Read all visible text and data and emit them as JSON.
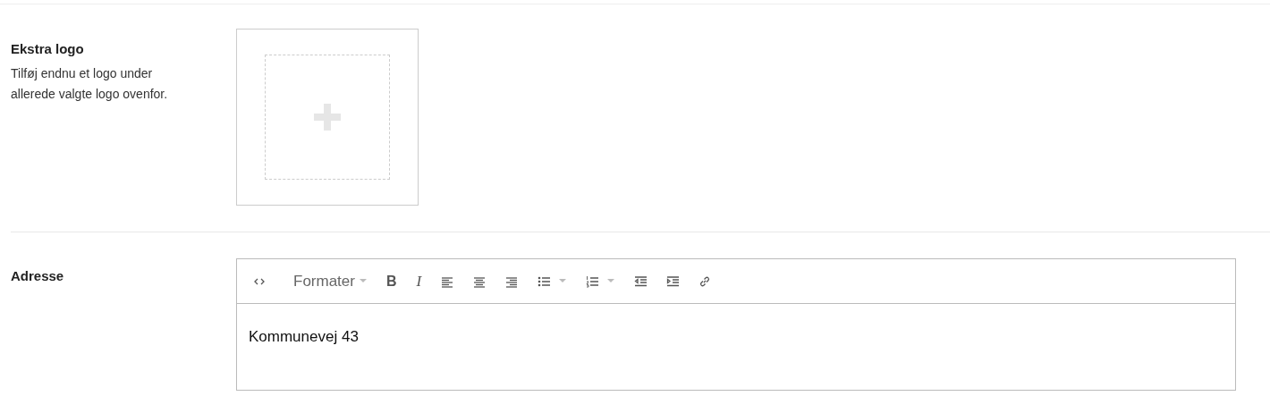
{
  "sections": [
    {
      "kind": "upload",
      "label": "Ekstra logo",
      "description": "Tilføj endnu et logo under allerede valgte logo ovenfor."
    },
    {
      "kind": "editor",
      "label": "Adresse",
      "toolbar": [
        {
          "kind": "code"
        },
        {
          "kind": "format",
          "label": "Formater"
        },
        {
          "kind": "bold",
          "label": "B"
        },
        {
          "kind": "italic",
          "label": "I"
        },
        {
          "kind": "align-left"
        },
        {
          "kind": "align-center"
        },
        {
          "kind": "align-right"
        },
        {
          "kind": "bullet-list"
        },
        {
          "kind": "number-list"
        },
        {
          "kind": "outdent"
        },
        {
          "kind": "indent"
        },
        {
          "kind": "link"
        }
      ],
      "content": "Kommunevej 43"
    }
  ]
}
